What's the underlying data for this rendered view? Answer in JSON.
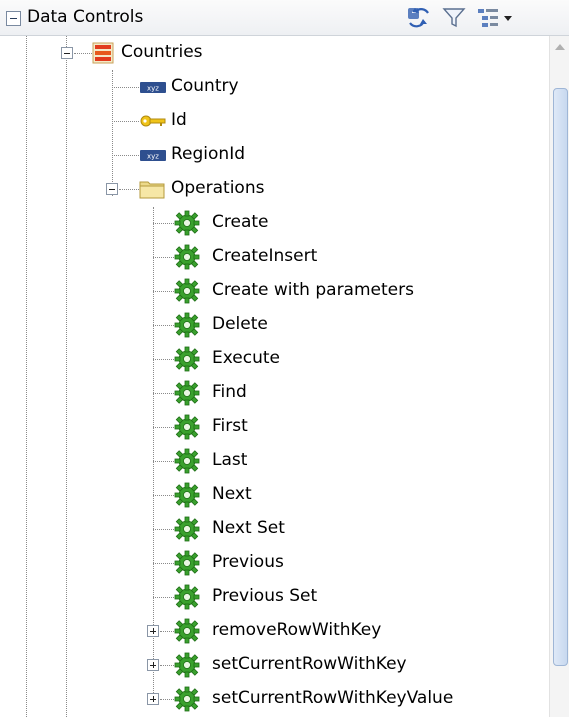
{
  "header": {
    "title": "Data Controls",
    "icons": [
      "refresh-icon",
      "filter-icon",
      "tree-options-icon"
    ]
  },
  "tree": {
    "root": {
      "label": "Countries",
      "icon": "collection-icon"
    },
    "attributes": [
      {
        "label": "Country",
        "icon": "attribute-icon"
      },
      {
        "label": "Id",
        "icon": "key-icon"
      },
      {
        "label": "RegionId",
        "icon": "attribute-icon"
      }
    ],
    "operations_folder": {
      "label": "Operations",
      "icon": "folder-icon"
    },
    "operations": [
      {
        "label": "Create"
      },
      {
        "label": "CreateInsert"
      },
      {
        "label": "Create with parameters"
      },
      {
        "label": "Delete"
      },
      {
        "label": "Execute"
      },
      {
        "label": "Find"
      },
      {
        "label": "First"
      },
      {
        "label": "Last"
      },
      {
        "label": "Next"
      },
      {
        "label": "Next Set"
      },
      {
        "label": "Previous"
      },
      {
        "label": "Previous Set"
      }
    ],
    "methods": [
      {
        "label": "removeRowWithKey"
      },
      {
        "label": "setCurrentRowWithKey"
      },
      {
        "label": "setCurrentRowWithKeyValue"
      }
    ]
  },
  "colors": {
    "accent_gear": "#3aa12e",
    "folder": "#e8d27a",
    "header_bg": "#f3f4f6"
  }
}
